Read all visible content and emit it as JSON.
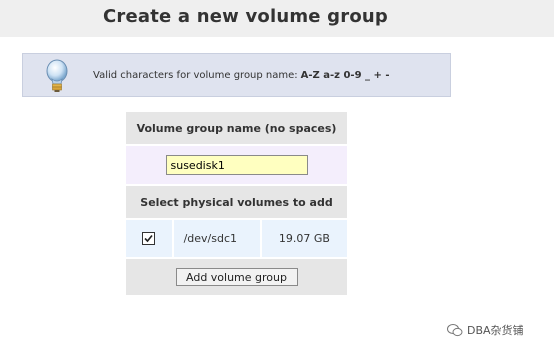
{
  "page": {
    "title": "Create a new volume group"
  },
  "hint": {
    "text": "Valid characters for volume group name:",
    "chars": "A-Z a-z 0-9 _ + -"
  },
  "form": {
    "name_header": "Volume group name (no spaces)",
    "name_value": "susedisk1",
    "pv_header": "Select physical volumes to add",
    "physical_volumes": [
      {
        "checked": true,
        "device": "/dev/sdc1",
        "size": "19.07 GB"
      }
    ],
    "submit_label": "Add volume group"
  },
  "watermark": {
    "text": "DBA杂货铺"
  }
}
